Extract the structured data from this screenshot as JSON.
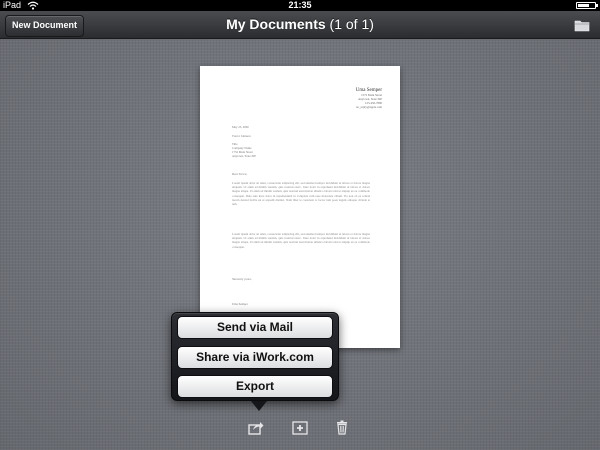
{
  "status_bar": {
    "carrier": "iPad",
    "time": "21:35",
    "battery_level": 0.75
  },
  "toolbar": {
    "new_document_label": "New Document",
    "title": "My Documents",
    "count": "(1 of 1)",
    "right_icon": "folder-icon"
  },
  "document": {
    "sender_name": "Uma Semper",
    "sender_address": [
      "1572 Main Street",
      "Anytown, State ZIP",
      "123-456-7890",
      "no_reply@apple.com"
    ],
    "date": "May 23, 2000",
    "recipient": [
      "Trevor Johnson",
      "Title",
      "Company Name",
      "1752 Main Street",
      "Anytown, State ZIP"
    ],
    "greeting": "Dear Trevor,",
    "paragraph_1": "Lorem ipsum dolor sit amet, consectetur adipiscing elit, sed eiusmod tempor incididunt ut labore et dolore magna aliquam. Ut enim ad minim veniam, quis nostrud exerc. Irure dolor in reprehend incididunt ut labore et dolore magna aliqua. Ut enim ad minim veniam, quis nostrud exercitation ullamco laboris nisi ut aliquip ex ea commodo consequat. Duis aute irure dolor in reprehenderit in voluptate velit esse molestaie cillum. Tia non ob ea soluad incom dereud facilis est er expedit distinct. Nam liber te conscient to factor tum poen legum odioque civiuda et tam.",
    "paragraph_2": "Lorem ipsum dolor sit amet, consectetur adipiscing elit, sed eiusmod tempor incididunt ut labore et dolore magna aliquam. Ut enim ad minim veniam, quis nostrud exerc. Irure dolor in reprehend incididunt ut labore et dolore magna aliqua. Ut enim ad minim veniam, quis nostrud exercitation ullamco laboris nisi ut aliquip ex ea commodo consequat.",
    "closing": "Sincerely yours,",
    "signature": "Uma Semper"
  },
  "popover": {
    "send_mail_label": "Send via Mail",
    "share_iwork_label": "Share via iWork.com",
    "export_label": "Export"
  },
  "bottom_bar": {
    "icons": [
      "share-icon",
      "add-document-icon",
      "trash-icon"
    ]
  },
  "colors": {
    "toolbar_top": "#4a4c50",
    "toolbar_bottom": "#2b2c2f",
    "background_linen": "#70737a",
    "popover": "#15161a"
  }
}
